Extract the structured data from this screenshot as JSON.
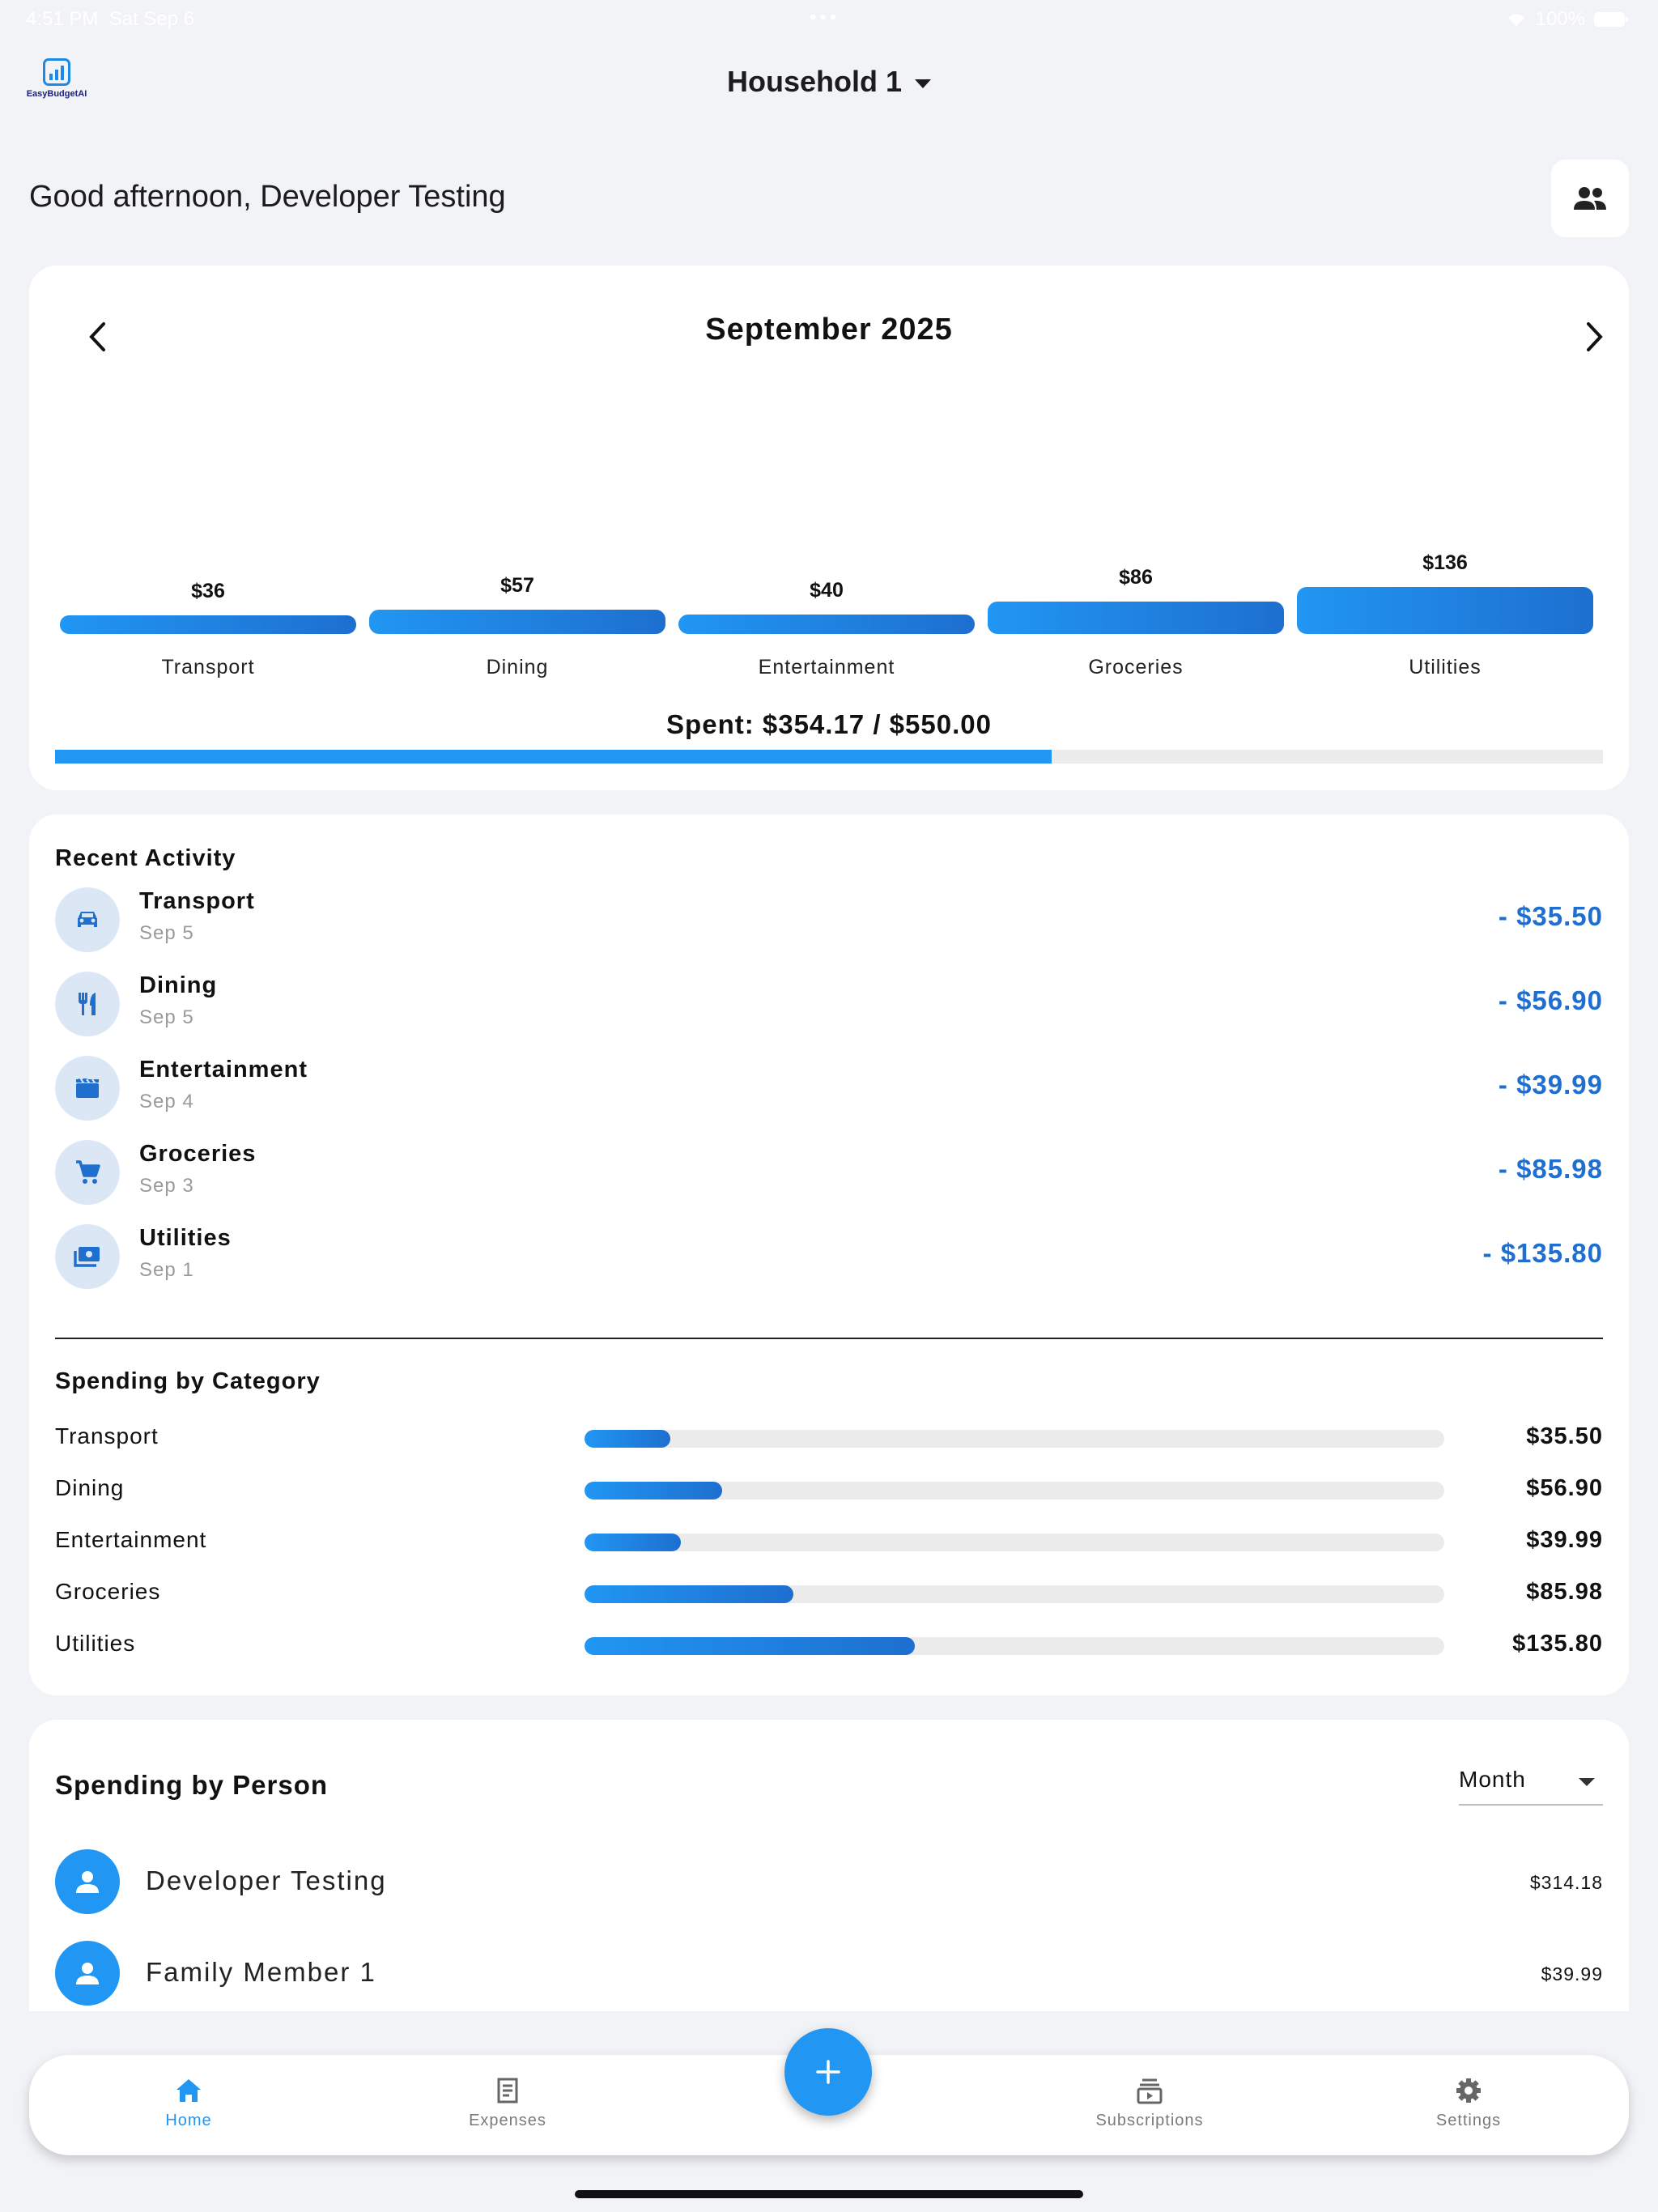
{
  "status_bar": {
    "time": "4:51 PM",
    "date": "Sat Sep 6",
    "battery": "100%"
  },
  "app": {
    "logo_text": "EasyBudgetAI",
    "household": "Household 1"
  },
  "greeting": "Good afternoon, Developer Testing",
  "month_card": {
    "title": "September 2025",
    "spent_text": "Spent: $354.17 / $550.00",
    "spent_fraction": 0.644
  },
  "chart_data": {
    "type": "bar",
    "title": "",
    "categories": [
      "Transport",
      "Dining",
      "Entertainment",
      "Groceries",
      "Utilities"
    ],
    "values": [
      35.5,
      56.9,
      39.99,
      85.98,
      135.8
    ],
    "data_labels": [
      "$36",
      "$57",
      "$40",
      "$86",
      "$136"
    ],
    "colors": {
      "start": "#2196f3",
      "end": "#1e6fcf"
    }
  },
  "recent_activity": {
    "title": "Recent Activity",
    "items": [
      {
        "name": "Transport",
        "date": "Sep 5",
        "amount": "- $35.50",
        "icon": "car-icon"
      },
      {
        "name": "Dining",
        "date": "Sep 5",
        "amount": "- $56.90",
        "icon": "restaurant-icon"
      },
      {
        "name": "Entertainment",
        "date": "Sep 4",
        "amount": "- $39.99",
        "icon": "movie-icon"
      },
      {
        "name": "Groceries",
        "date": "Sep 3",
        "amount": "- $85.98",
        "icon": "cart-icon"
      },
      {
        "name": "Utilities",
        "date": "Sep 1",
        "amount": "- $135.80",
        "icon": "bill-icon"
      }
    ]
  },
  "spending_by_category": {
    "title": "Spending by Category",
    "items": [
      {
        "name": "Transport",
        "amount": "$35.50",
        "fraction": 0.1
      },
      {
        "name": "Dining",
        "amount": "$56.90",
        "fraction": 0.16
      },
      {
        "name": "Entertainment",
        "amount": "$39.99",
        "fraction": 0.112
      },
      {
        "name": "Groceries",
        "amount": "$85.98",
        "fraction": 0.243
      },
      {
        "name": "Utilities",
        "amount": "$135.80",
        "fraction": 0.384
      }
    ]
  },
  "spending_by_person": {
    "title": "Spending by Person",
    "period": "Month",
    "people": [
      {
        "name": "Developer Testing",
        "amount": "$314.18"
      },
      {
        "name": "Family Member 1",
        "amount": "$39.99"
      }
    ]
  },
  "bottom_nav": {
    "items": [
      {
        "label": "Home",
        "icon": "home-icon",
        "active": true
      },
      {
        "label": "Expenses",
        "icon": "receipt-icon",
        "active": false
      },
      {
        "label": "Subscriptions",
        "icon": "subscriptions-icon",
        "active": false
      },
      {
        "label": "Settings",
        "icon": "gear-icon",
        "active": false
      }
    ]
  },
  "accent_color": "#2196f3"
}
